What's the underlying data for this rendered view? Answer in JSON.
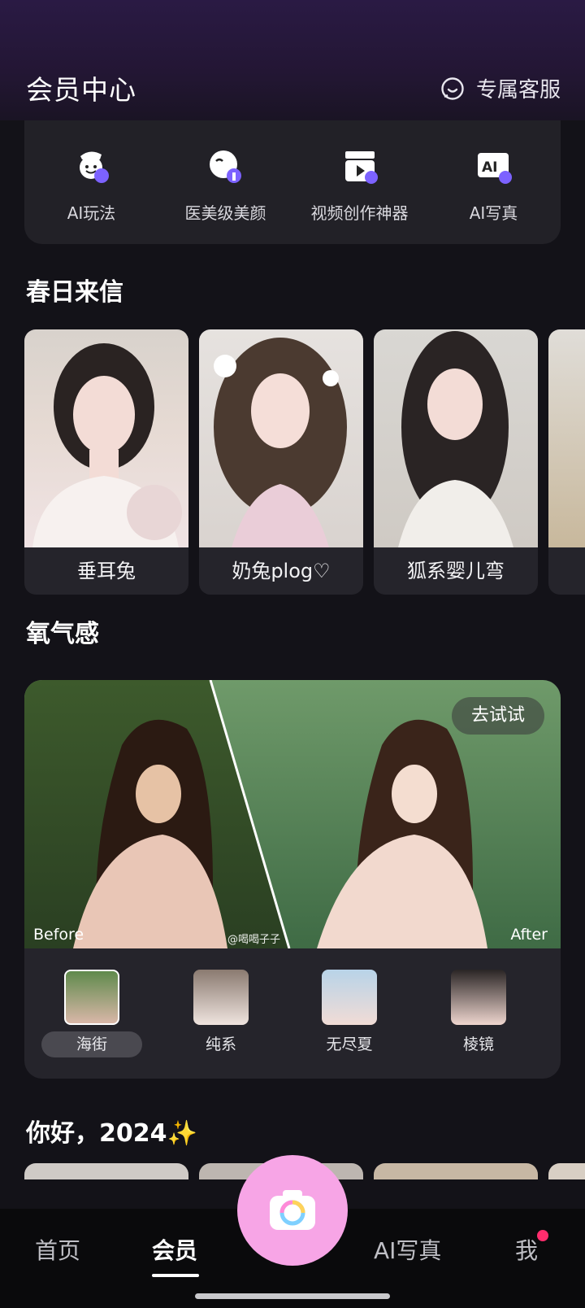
{
  "header": {
    "title": "会员中心",
    "support_label": "专属客服",
    "support_icon": "chat-smile-icon"
  },
  "features": [
    {
      "label": "AI玩法",
      "icon": "ai-play-icon"
    },
    {
      "label": "医美级美颜",
      "icon": "beauty-face-icon"
    },
    {
      "label": "视频创作神器",
      "icon": "video-clapper-icon"
    },
    {
      "label": "AI写真",
      "icon": "ai-portrait-icon"
    }
  ],
  "sections": {
    "spring": {
      "title": "春日来信",
      "cards": [
        {
          "label": "垂耳兔"
        },
        {
          "label": "奶兔plog♡"
        },
        {
          "label": "狐系婴儿弯"
        }
      ]
    },
    "oxygen": {
      "title": "氧气感",
      "try_label": "去试试",
      "before_label": "Before",
      "after_label": "After",
      "credit": "@喝喝子子",
      "filters": [
        {
          "label": "海街",
          "selected": true
        },
        {
          "label": "纯系",
          "selected": false
        },
        {
          "label": "无尽夏",
          "selected": false
        },
        {
          "label": "棱镜",
          "selected": false
        }
      ]
    },
    "hello": {
      "title": "你好，2024✨"
    }
  },
  "tabbar": {
    "tabs": [
      {
        "label": "首页"
      },
      {
        "label": "会员",
        "active": true
      },
      {
        "label": "AI写真"
      },
      {
        "label": "我"
      }
    ],
    "camera_icon": "camera-icon"
  },
  "colors": {
    "accent_pink": "#f7a5e6",
    "badge_red": "#ff2d6d",
    "icon_purple": "#7c62ff"
  }
}
